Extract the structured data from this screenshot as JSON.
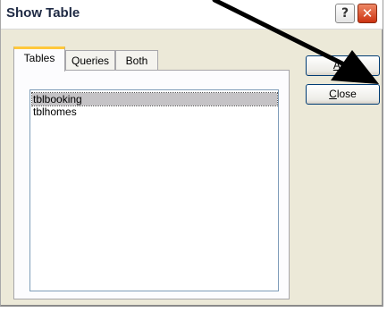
{
  "window": {
    "title": "Show Table"
  },
  "titlebar_buttons": {
    "help": "?",
    "close": "✕"
  },
  "tabs": [
    {
      "label": "Tables",
      "active": true
    },
    {
      "label": "Queries",
      "active": false
    },
    {
      "label": "Both",
      "active": false
    }
  ],
  "list": {
    "items": [
      {
        "label": "tblbooking",
        "selected": true
      },
      {
        "label": "tblhomes",
        "selected": false
      }
    ]
  },
  "buttons": {
    "add": {
      "accel": "A",
      "rest": "dd"
    },
    "close": {
      "accel": "C",
      "rest": "lose"
    }
  },
  "annotation": {
    "type": "arrow",
    "color": "#000000"
  }
}
